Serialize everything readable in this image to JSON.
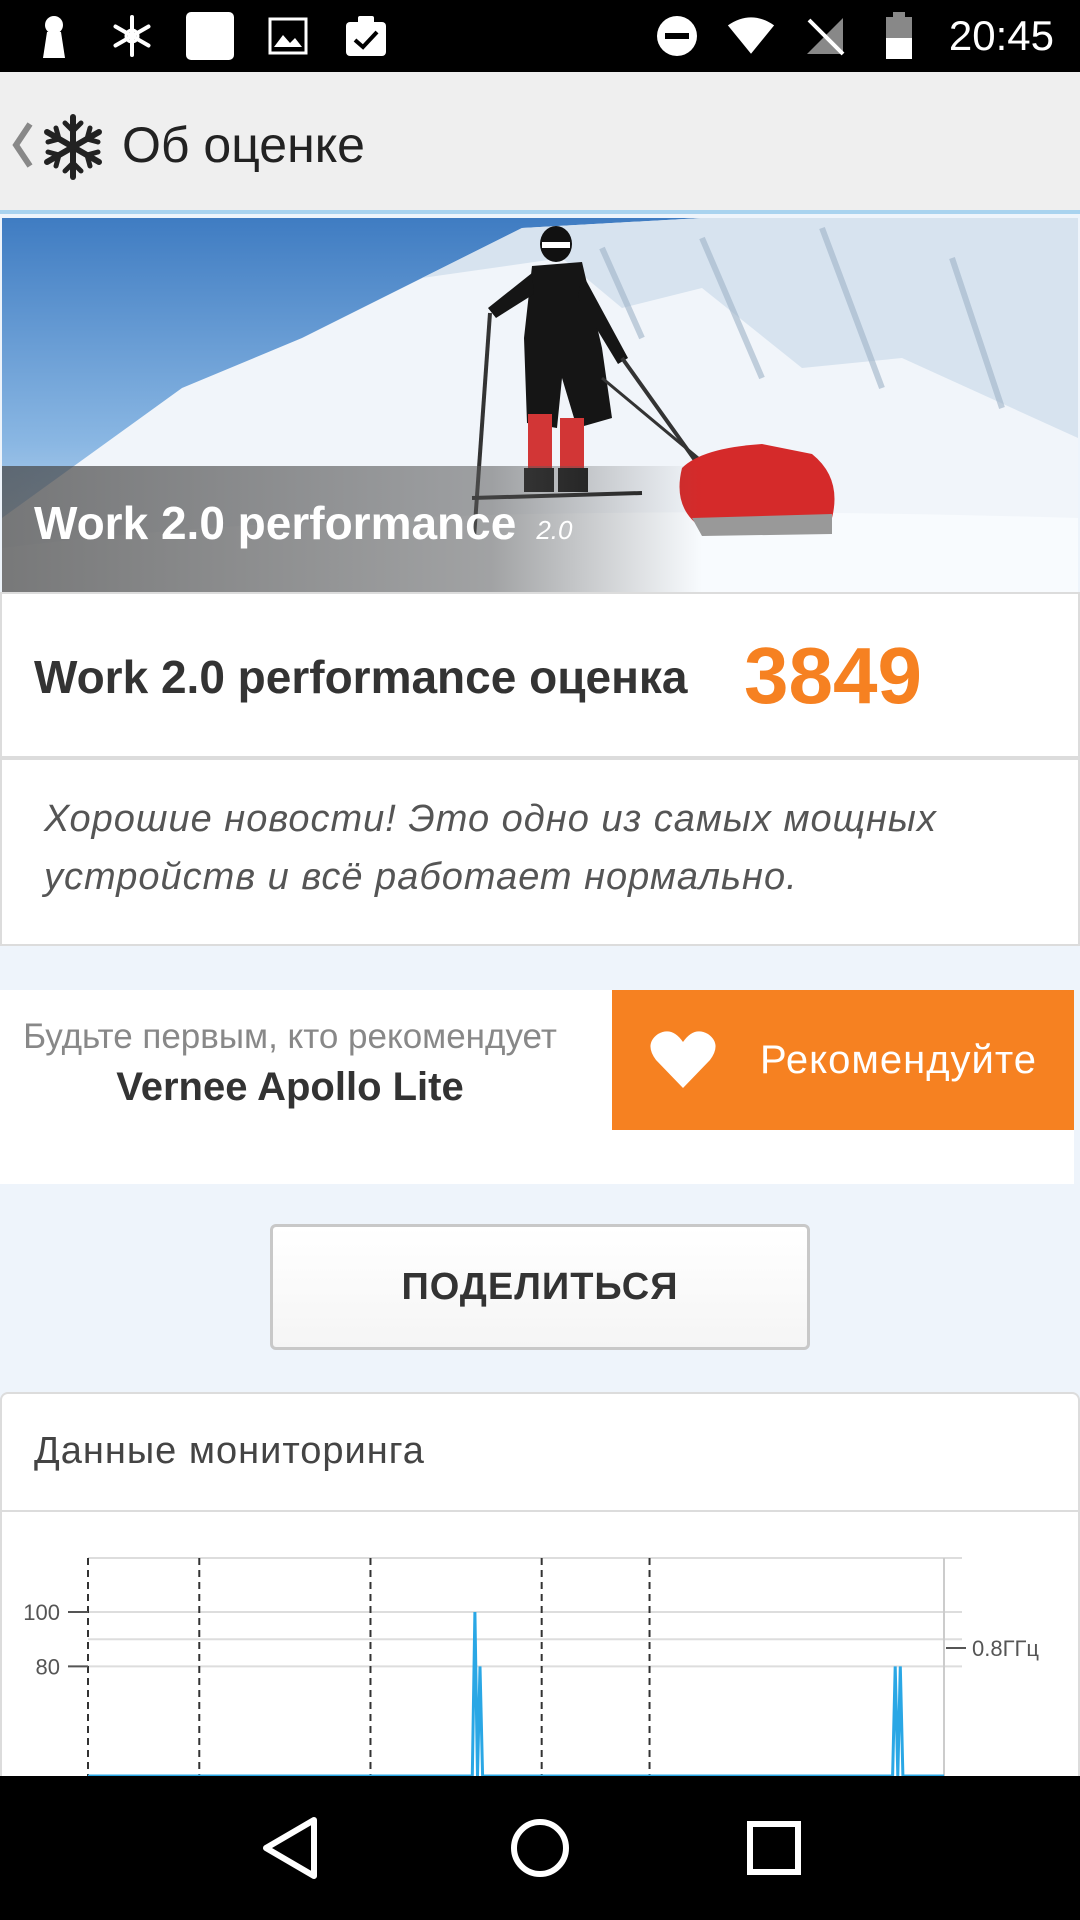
{
  "status_bar": {
    "time": "20:45",
    "icons": [
      "keyhole-icon",
      "snowflake-icon",
      "blank-square-icon",
      "image-icon",
      "clipboard-check-icon",
      "do-not-disturb-icon",
      "wifi-icon",
      "no-sim-icon",
      "battery-icon"
    ]
  },
  "toolbar": {
    "title": "Об оценке",
    "back_icon": "chevron-left-icon",
    "logo_icon": "snowflake-logo-icon"
  },
  "hero": {
    "title": "Work 2.0 performance",
    "version": "2.0"
  },
  "score": {
    "label": "Work 2.0 performance оценка",
    "value": "3849",
    "color": "#f68121"
  },
  "message": {
    "text": "Хорошие новости! Это одно из самых мощных устройств и всё работает нормально."
  },
  "recommend": {
    "prefix": "Будьте первым, кто рекомендует",
    "device": "Vernee Apollo Lite",
    "button_label": "Рекомендуйте",
    "button_color": "#f68121"
  },
  "share": {
    "button_label": "ПОДЕЛИТЬСЯ"
  },
  "monitoring": {
    "title": "Данные мониторинга"
  },
  "chart_data": {
    "type": "line",
    "y_ticks": [
      "100",
      "80"
    ],
    "y2_tick": "0.8ГГц",
    "series": [
      {
        "x": [
          0,
          0.449,
          0.452,
          0.455,
          0.458,
          0.461,
          0.464,
          0.467,
          0.47,
          0.94,
          0.943,
          0.946,
          0.949,
          0.952,
          0.955,
          0.958,
          1.0
        ],
        "values": [
          0,
          0,
          100,
          0,
          80,
          0,
          0,
          0,
          0,
          0,
          80,
          0,
          80,
          0,
          0,
          0,
          0
        ]
      }
    ],
    "color": "#2aa7e5"
  },
  "nav_bar": {
    "icons": [
      "back-triangle-icon",
      "home-circle-icon",
      "recents-square-icon"
    ]
  }
}
